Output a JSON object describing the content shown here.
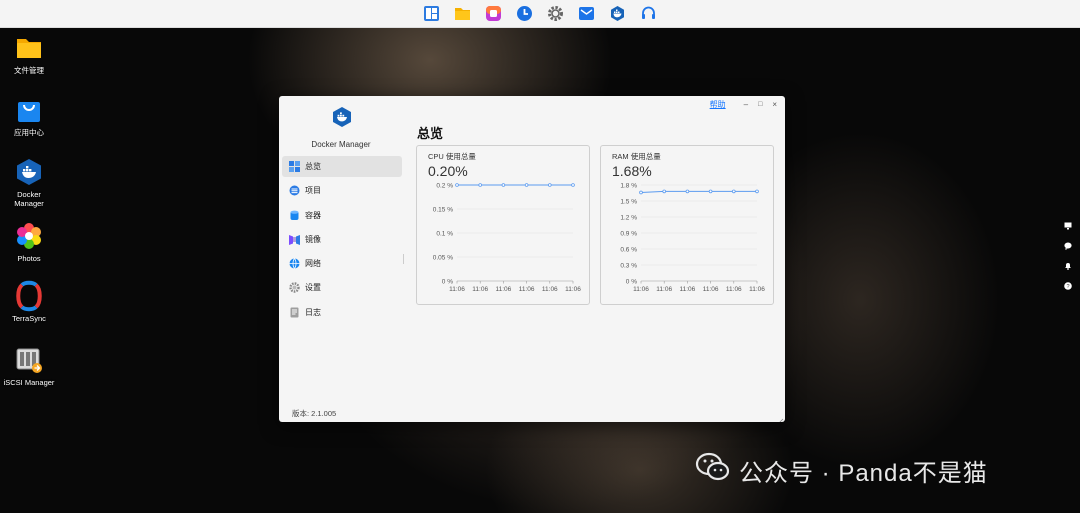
{
  "taskbar": {
    "icons": [
      "control-panel-icon",
      "file-manager-icon",
      "photos-app-icon",
      "clock-icon",
      "settings-gear-icon",
      "mail-icon",
      "docker-icon",
      "support-headset-icon"
    ]
  },
  "desktop": {
    "items": [
      {
        "label": "文件管理",
        "icon": "folder-icon"
      },
      {
        "label": "应用中心",
        "icon": "app-center-bag-icon"
      },
      {
        "label": "Docker\nManager",
        "icon": "docker-icon"
      },
      {
        "label": "Photos",
        "icon": "photos-flower-icon"
      },
      {
        "label": "TerraSync",
        "icon": "terrasync-icon"
      },
      {
        "label": "iSCSI Manager",
        "icon": "iscsi-icon"
      }
    ]
  },
  "window": {
    "help_label": "帮助",
    "minimize_label": "–",
    "maximize_label": "□",
    "close_label": "×",
    "app_name": "Docker Manager",
    "version": "版本: 2.1.005",
    "page_title": "总览",
    "nav": [
      {
        "label": "总览",
        "icon": "overview-grid-icon",
        "active": true
      },
      {
        "label": "项目",
        "icon": "project-stack-icon",
        "active": false
      },
      {
        "label": "容器",
        "icon": "container-cylinder-icon",
        "active": false
      },
      {
        "label": "镜像",
        "icon": "image-icon",
        "active": false
      },
      {
        "label": "网络",
        "icon": "network-globe-icon",
        "active": false
      },
      {
        "label": "设置",
        "icon": "settings-icon",
        "active": false
      },
      {
        "label": "日志",
        "icon": "log-document-icon",
        "active": false
      }
    ]
  },
  "cpu": {
    "title": "CPU 使用总量",
    "value": "0.20%",
    "y_ticks": [
      "0.2 %",
      "0.15 %",
      "0.1 %",
      "0.05 %",
      "0 %"
    ],
    "x_ticks": [
      "11:06",
      "11:06",
      "11:06",
      "11:06",
      "11:06",
      "11:06"
    ],
    "ylim": [
      0,
      0.2
    ],
    "points": [
      0.2,
      0.2,
      0.2,
      0.2,
      0.2,
      0.2
    ],
    "color": "#5b9bf0"
  },
  "ram": {
    "title": "RAM 使用总量",
    "value": "1.68%",
    "y_ticks": [
      "1.8 %",
      "1.5 %",
      "1.2 %",
      "0.9 %",
      "0.6 %",
      "0.3 %",
      "0 %"
    ],
    "x_ticks": [
      "11:06",
      "11:06",
      "11:06",
      "11:06",
      "11:06",
      "11:06"
    ],
    "ylim": [
      0,
      1.8
    ],
    "points": [
      1.66,
      1.68,
      1.68,
      1.68,
      1.68,
      1.68
    ],
    "color": "#5b9bf0"
  },
  "watermark": {
    "text": "公众号 · Panda不是猫",
    "icon": "wechat-icon"
  },
  "side_tools": [
    "monitor-icon",
    "chat-bubble-icon",
    "bell-icon",
    "help-circle-icon"
  ]
}
